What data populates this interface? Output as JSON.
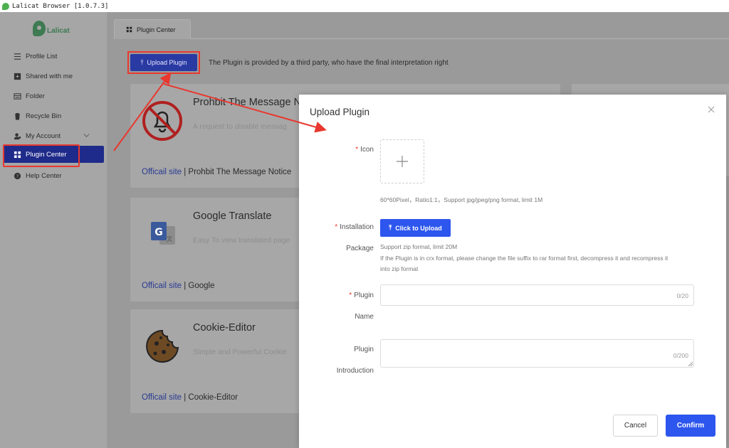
{
  "window": {
    "title": "Lalicat Browser  [1.0.7.3]"
  },
  "brand": {
    "logo_text": "Lalicat"
  },
  "sidebar": {
    "items": [
      {
        "label": "Profile List",
        "icon": "list-icon"
      },
      {
        "label": "Shared with me",
        "icon": "shared-icon"
      },
      {
        "label": "Folder",
        "icon": "folder-icon"
      },
      {
        "label": "Recycle Bin",
        "icon": "trash-icon"
      },
      {
        "label": "My Account",
        "icon": "account-icon"
      },
      {
        "label": "Plugin Center",
        "icon": "grid-icon",
        "active": true
      },
      {
        "label": "Help Center",
        "icon": "help-icon"
      }
    ]
  },
  "tabs": [
    {
      "label": "Plugin Center"
    }
  ],
  "toolbar": {
    "upload_label": "Upload Plugin",
    "notice": "The Plugin is provided by a third party, who have the final interpretation right"
  },
  "plugins": [
    {
      "name": "Prohbit The Message N",
      "desc": "A request to disable messag",
      "link": "Officail site",
      "source": " | Prohbit The Message Notice"
    },
    {
      "name": "Google Translate",
      "desc": "Easy To view translated page",
      "link": "Officail site",
      "source": " | Google"
    },
    {
      "name": "Cookie-Editor",
      "desc": "Simple and Powerful Cookie",
      "link": "Officail site",
      "source": " | Cookie-Editor"
    }
  ],
  "modal": {
    "title": "Upload Plugin",
    "icon_label": "Icon",
    "icon_hint": "60*60Pixel，Ratio1:1，Support jpg/jpeg/png format, limit 1M",
    "install_label_1": "Installation",
    "install_label_2": "Package",
    "click_upload_label": "Click to Upload",
    "install_hint_1": "Support zip format, limit 20M",
    "install_hint_2": "If the Plugin is in crx format, please change the file suffix to rar format first, decompress it and recompress it",
    "install_hint_3": "into zip format",
    "name_label_1": "Plugin",
    "name_label_2": "Name",
    "name_value": "",
    "name_count": "0/20",
    "intro_label_1": "Plugin",
    "intro_label_2": "Introduction",
    "intro_value": "",
    "intro_count": "0/200",
    "cancel_label": "Cancel",
    "confirm_label": "Confirm"
  },
  "colors": {
    "primary": "#2d56ee",
    "active_nav": "#1f2b8a",
    "annotation": "#e8382f"
  }
}
